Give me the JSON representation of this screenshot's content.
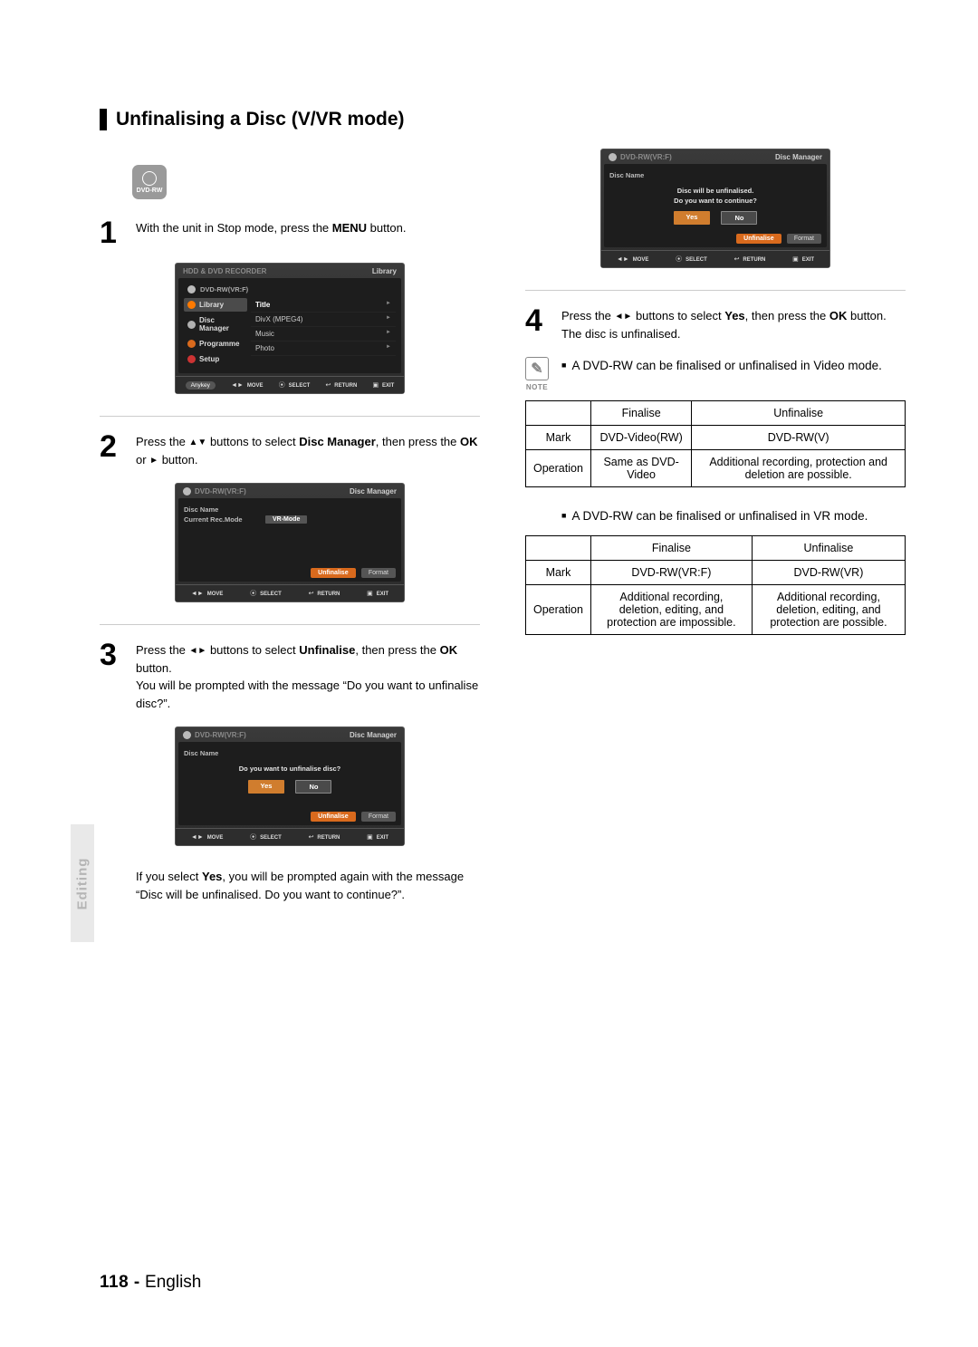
{
  "title": "Unfinalising a Disc (V/VR mode)",
  "disc_badge": {
    "label": "DVD-RW"
  },
  "side_tab": "Editing",
  "steps": {
    "s1": {
      "num": "1",
      "text": [
        "With the unit in Stop mode, press the ",
        "MENU",
        " button."
      ]
    },
    "s2": {
      "num": "2",
      "text": [
        "Press the ",
        "▲▼",
        " buttons to select ",
        "Disc Manager",
        ", then press the ",
        "OK",
        " or ",
        "►",
        " button."
      ]
    },
    "s3": {
      "num": "3",
      "text": [
        "Press the ",
        "◄►",
        " buttons to select ",
        "Unfinalise",
        ", then press the ",
        "OK",
        " button."
      ],
      "after": "You will be prompted with the message “Do you want to unfinalise disc?”."
    },
    "s3_followup": "If you select Yes, you will be prompted again with the message “Disc will be unfinalised. Do you want to continue?”.",
    "s4": {
      "num": "4",
      "text": [
        "Press the ",
        "◄►",
        " buttons to select ",
        "Yes",
        ", then press the ",
        "OK",
        " button."
      ],
      "after": "The disc is unfinalised."
    }
  },
  "osd": {
    "top_title": "HDD & DVD RECORDER",
    "library": "Library",
    "disc_label": "DVD-RW(VR:F)",
    "disc_manager": "Disc Manager",
    "sidebar": [
      "Library",
      "Disc Manager",
      "Programme",
      "Setup"
    ],
    "menu_items": [
      "Title",
      "DivX (MPEG4)",
      "Music",
      "Photo"
    ],
    "footer": {
      "anykey": "Anykey",
      "move": "MOVE",
      "select": "SELECT",
      "return": "RETURN",
      "exit": "EXIT"
    },
    "disc_name_label": "Disc Name",
    "rec_mode_label": "Current Rec.Mode",
    "rec_mode_value": "VR-Mode",
    "btn_unfinalise": "Unfinalise",
    "btn_format": "Format",
    "prompt_unfinalise": "Do you want to unfinalise disc?",
    "prompt_continue1": "Disc will be unfinalised.",
    "prompt_continue2": "Do you want to continue?",
    "yes": "Yes",
    "no": "No"
  },
  "note": {
    "label": "NOTE",
    "bullet1": "A DVD-RW can be finalised or unfinalised in Video mode.",
    "bullet2": "A DVD-RW can be finalised or unfinalised in VR mode."
  },
  "table_video": {
    "headers": [
      "",
      "Finalise",
      "Unfinalise"
    ],
    "rows": [
      {
        "label": "Mark",
        "c1": "DVD-Video(RW)",
        "c2": "DVD-RW(V)"
      },
      {
        "label": "Operation",
        "c1": "Same as DVD-Video",
        "c2": "Additional recording, protection and deletion are possible."
      }
    ]
  },
  "table_vr": {
    "headers": [
      "",
      "Finalise",
      "Unfinalise"
    ],
    "rows": [
      {
        "label": "Mark",
        "c1": "DVD-RW(VR:F)",
        "c2": "DVD-RW(VR)"
      },
      {
        "label": "Operation",
        "c1": "Additional recording, deletion, editing, and protection are impossible.",
        "c2": "Additional recording, deletion, editing, and protection are possible."
      }
    ]
  },
  "footer": {
    "page": "118 -",
    "lang": "English"
  }
}
